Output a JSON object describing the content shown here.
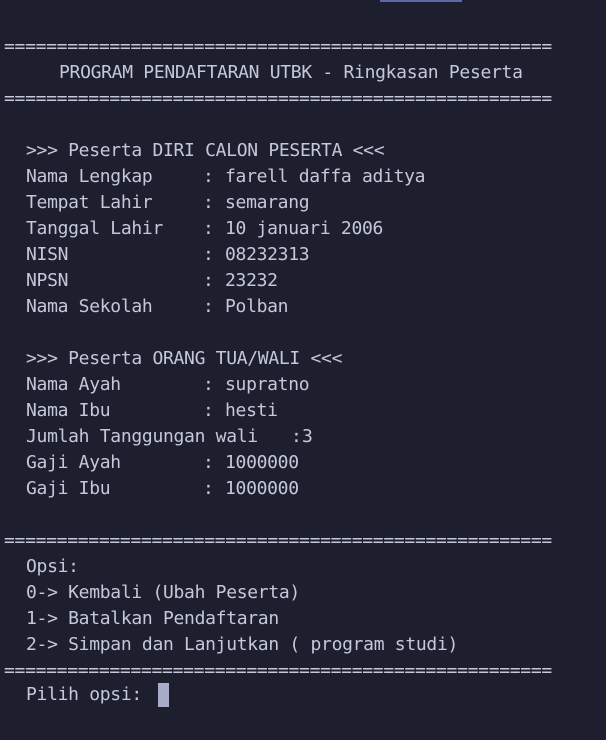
{
  "separator": "====================================================",
  "title": "PROGRAM PENDAFTARAN UTBK - Ringkasan Peserta",
  "section_personal": {
    "heading": ">>> Peserta DIRI CALON PESERTA <<<",
    "fields": [
      {
        "label": "Nama Lengkap",
        "value": "farell daffa aditya"
      },
      {
        "label": "Tempat Lahir",
        "value": "semarang"
      },
      {
        "label": "Tanggal Lahir",
        "value": "10 januari 2006"
      },
      {
        "label": "NISN",
        "value": "08232313"
      },
      {
        "label": "NPSN",
        "value": "23232"
      },
      {
        "label": "Nama Sekolah",
        "value": "Polban"
      }
    ]
  },
  "section_parents": {
    "heading": ">>> Peserta ORANG TUA/WALI <<<",
    "fields": [
      {
        "label": "Nama Ayah",
        "value": "supratno"
      },
      {
        "label": "Nama Ibu",
        "value": "hesti"
      },
      {
        "label": "Jumlah Tanggungan wali",
        "value": "3"
      },
      {
        "label": "Gaji Ayah",
        "value": "1000000"
      },
      {
        "label": "Gaji Ibu",
        "value": "1000000"
      }
    ]
  },
  "options": {
    "heading": "Opsi:",
    "items": [
      "0-> Kembali (Ubah Peserta)",
      "1-> Batalkan Pendaftaran",
      "2-> Simpan dan Lanjutkan ( program studi)"
    ]
  },
  "prompt": "Pilih opsi: ",
  "colon": ":",
  "colors": {
    "background": "#1e1f2e",
    "text": "#c4c8da",
    "cursor": "#a9acc8"
  }
}
